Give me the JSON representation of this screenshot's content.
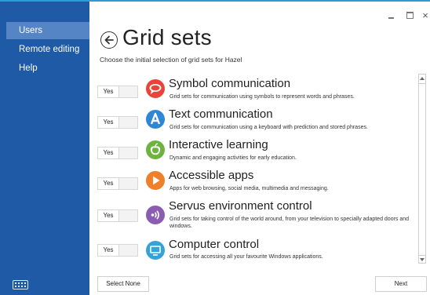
{
  "window": {
    "close_glyph": "×"
  },
  "sidebar": {
    "items": [
      {
        "label": "Users",
        "active": true
      },
      {
        "label": "Remote editing",
        "active": false
      },
      {
        "label": "Help",
        "active": false
      }
    ],
    "footer_icon": "keyboard-icon"
  },
  "header": {
    "back_icon": "back-arrow-circle-icon",
    "title": "Grid sets",
    "subtitle": "Choose the initial selection of grid sets for Hazel"
  },
  "grid_sets": [
    {
      "toggle": "Yes",
      "icon": "speech-bubble-icon",
      "color": "#e8443a",
      "name": "Symbol communication",
      "description": "Grid sets for communication using symbols to represent words and phrases."
    },
    {
      "toggle": "Yes",
      "icon": "letter-a-icon",
      "color": "#2f86d4",
      "name": "Text communication",
      "description": "Grid sets for communication using a keyboard with prediction and stored phrases."
    },
    {
      "toggle": "Yes",
      "icon": "apple-icon",
      "color": "#6cb33f",
      "name": "Interactive learning",
      "description": "Dynamic and engaging activities for early education."
    },
    {
      "toggle": "Yes",
      "icon": "play-icon",
      "color": "#f07f2a",
      "name": "Accessible apps",
      "description": "Apps for web browsing, social media, multimedia and messaging."
    },
    {
      "toggle": "Yes",
      "icon": "signal-icon",
      "color": "#8a5db3",
      "name": "Servus environment control",
      "description": "Grid sets for taking control of the world around, from your television to specially adapted doors and windows."
    },
    {
      "toggle": "Yes",
      "icon": "monitor-icon",
      "color": "#35a2d8",
      "name": "Computer control",
      "description": "Grid sets for accessing all your favourite Windows applications."
    }
  ],
  "footer": {
    "select_none": "Select None",
    "next": "Next"
  }
}
